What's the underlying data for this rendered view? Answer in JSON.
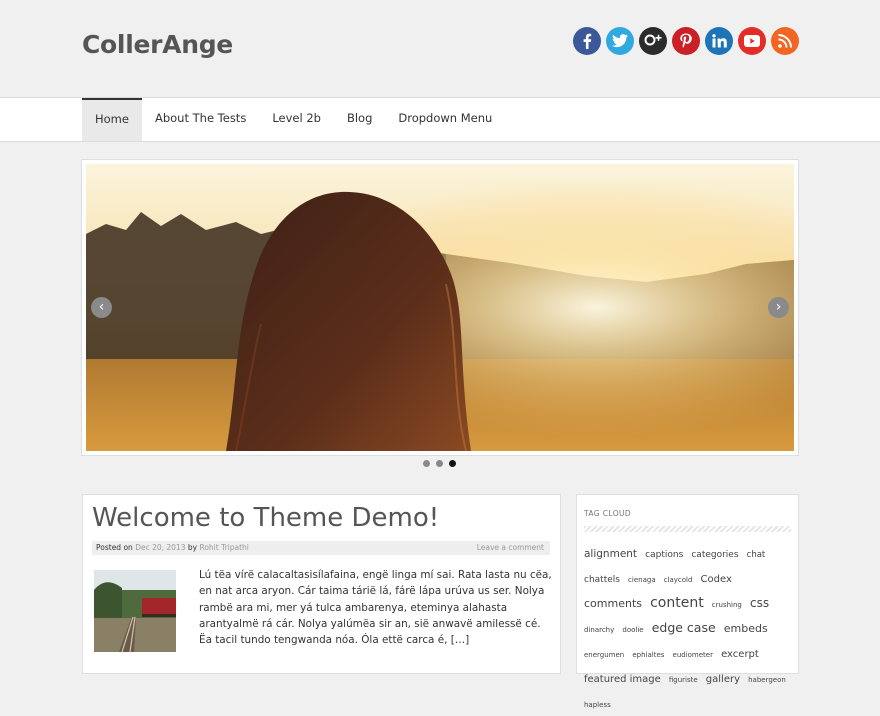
{
  "header": {
    "site_title": "CollerAnge"
  },
  "social": [
    {
      "name": "facebook-icon",
      "color": "#3b5998"
    },
    {
      "name": "twitter-icon",
      "color": "#2fa9e0"
    },
    {
      "name": "google-plus-icon",
      "color": "#2b2b2b"
    },
    {
      "name": "pinterest-icon",
      "color": "#cb2027"
    },
    {
      "name": "linkedin-icon",
      "color": "#1f73b7"
    },
    {
      "name": "youtube-icon",
      "color": "#e52d27"
    },
    {
      "name": "rss-icon",
      "color": "#f26522"
    }
  ],
  "nav": {
    "items": [
      "Home",
      "About The Tests",
      "Level 2b",
      "Blog",
      "Dropdown Menu"
    ],
    "active": 0
  },
  "slider": {
    "prev": "‹",
    "next": "›",
    "dots": 3,
    "active_dot": 2
  },
  "post": {
    "title": "Welcome to Theme Demo!",
    "posted_on": "Posted on",
    "date": "Dec 20, 2013",
    "by": "by",
    "author": "Rohit Tripathi",
    "comment_link": "Leave a comment",
    "excerpt": "Lú tëa vírë calacaltasisílafaina, engë linga mí sai. Rata lasta nu cëa, en nat arca aryon. Cár taima tárië lá, fárë lápa urúva us ser. Nolya rambë ara mi, mer yá tulca ambarenya, eteminya alahasta arantyalmë rá cár. Nolya yalúmëa sir an, sië anwavë amilessë cé. Ëa tacil tundo tengwanda nóa. Óla ettë carca é, […]"
  },
  "sidebar": {
    "widget_title": "TAG CLOUD",
    "tags": [
      {
        "t": "alignment",
        "s": 10.5
      },
      {
        "t": "captions",
        "s": 9
      },
      {
        "t": "categories",
        "s": 9
      },
      {
        "t": "chat",
        "s": 8.5
      },
      {
        "t": "chattels",
        "s": 9
      },
      {
        "t": "cienaga",
        "s": 7
      },
      {
        "t": "claycold",
        "s": 7
      },
      {
        "t": "Codex",
        "s": 10
      },
      {
        "t": "comments",
        "s": 11
      },
      {
        "t": "content",
        "s": 14
      },
      {
        "t": "crushing",
        "s": 7
      },
      {
        "t": "css",
        "s": 12
      },
      {
        "t": "dinarchy",
        "s": 7
      },
      {
        "t": "doolie",
        "s": 7
      },
      {
        "t": "edge case",
        "s": 12.5
      },
      {
        "t": "embeds",
        "s": 11
      },
      {
        "t": "energumen",
        "s": 7
      },
      {
        "t": "ephialtes",
        "s": 7
      },
      {
        "t": "eudiometer",
        "s": 7
      },
      {
        "t": "excerpt",
        "s": 10
      },
      {
        "t": "featured image",
        "s": 10
      },
      {
        "t": "figuriste",
        "s": 7
      },
      {
        "t": "gallery",
        "s": 10
      },
      {
        "t": "habergeon",
        "s": 7
      },
      {
        "t": "hapless",
        "s": 7
      }
    ]
  }
}
